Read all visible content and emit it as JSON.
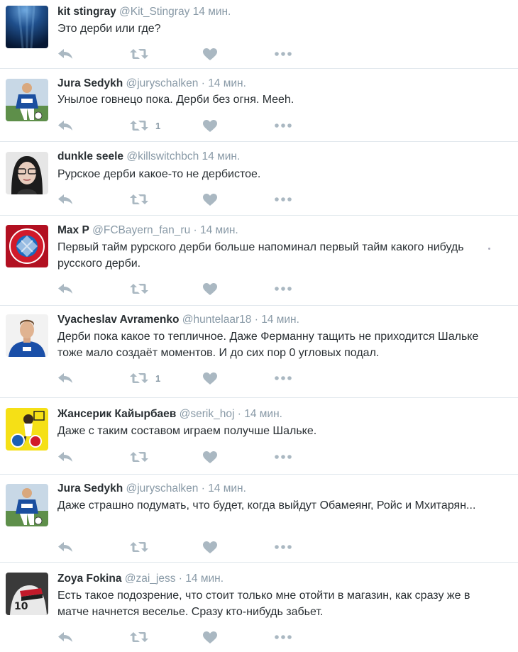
{
  "colors": {
    "meta": "#8899a6",
    "text": "#292f33",
    "divider": "#e1e8ed",
    "icon": "#aab8c2"
  },
  "icons": {
    "reply": "reply-icon",
    "retweet": "retweet-icon",
    "like": "heart-icon",
    "more": "more-dots-icon"
  },
  "tweets": [
    {
      "name": "kit stingray",
      "handle": "@Kit_Stingray",
      "sep": "",
      "time": "14 мин.",
      "text": "Это дерби или где?",
      "retweets": "",
      "avatar": "ocean"
    },
    {
      "name": "Jura Sedykh",
      "handle": "@juryschalken",
      "sep": "·",
      "time": "14 мин.",
      "text": "Унылое говнецо пока. Дерби без огня. Meeh.",
      "retweets": "1",
      "avatar": "football"
    },
    {
      "name": "dunkle seele",
      "handle": "@killswitchbch",
      "sep": "",
      "time": "14 мин.",
      "text": "Рурское дерби какое-то не дербистое.",
      "retweets": "",
      "avatar": "girl"
    },
    {
      "name": "Max P",
      "handle": "@FCBayern_fan_ru",
      "sep": "·",
      "time": "14 мин.",
      "text": "Первый тайм рурского дерби больше напоминал первый тайм какого нибудь русского дерби.",
      "retweets": "",
      "avatar": "bayern"
    },
    {
      "name": "Vyacheslav Avramenko",
      "handle": "@huntelaar18",
      "sep": "·",
      "time": "14 мин.",
      "text": "Дерби пока какое то тепличное. Даже Ферманну тащить не приходится Шальке тоже мало создаёт моментов. И до сих пор 0 угловых подал.",
      "retweets": "1",
      "avatar": "player"
    },
    {
      "name": "Жансерик Кайырбаев",
      "handle": "@serik_hoj",
      "sep": "·",
      "time": "14 мин.",
      "text": "Даже с таким составом играем получше Шальке.",
      "retweets": "",
      "avatar": "bvb"
    },
    {
      "name": "Jura Sedykh",
      "handle": "@juryschalken",
      "sep": "·",
      "time": "14 мин.",
      "text": "Даже страшно подумать, что будет, когда выйдут Обамеянг, Ройс и Мхитарян...",
      "retweets": "",
      "avatar": "football"
    },
    {
      "name": "Zoya Fokina",
      "handle": "@zai_jess",
      "sep": "·",
      "time": "14 мин.",
      "text": "Есть такое подозрение, что стоит только мне отойти в магазин, как сразу же в матче начнется веселье. Сразу кто-нибудь забьет.",
      "retweets": "",
      "avatar": "jersey"
    }
  ]
}
